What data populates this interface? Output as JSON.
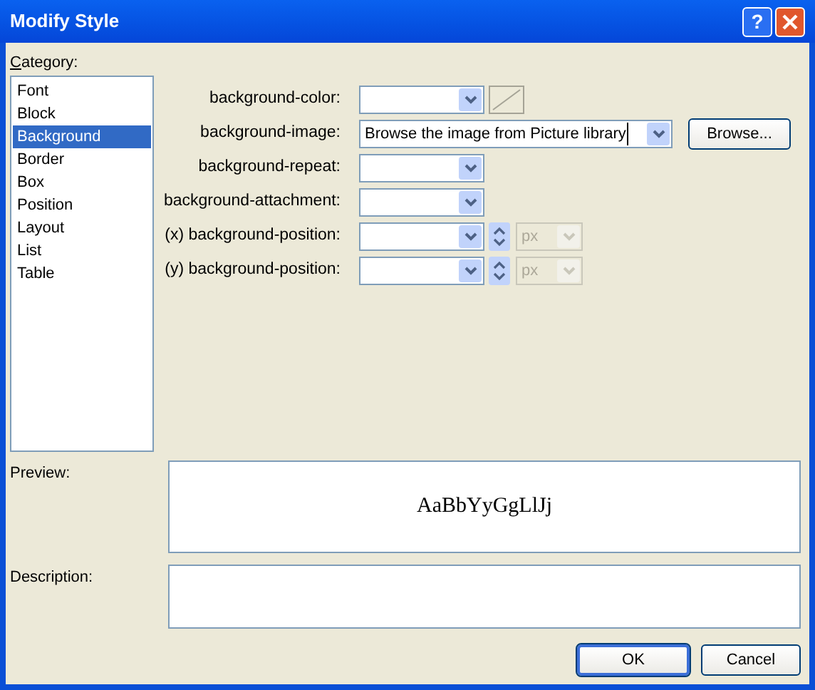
{
  "window": {
    "title": "Modify Style",
    "help_button": "?"
  },
  "category": {
    "label": "Category:",
    "items": [
      {
        "label": "Font",
        "selected": false
      },
      {
        "label": "Block",
        "selected": false
      },
      {
        "label": "Background",
        "selected": true
      },
      {
        "label": "Border",
        "selected": false
      },
      {
        "label": "Box",
        "selected": false
      },
      {
        "label": "Position",
        "selected": false
      },
      {
        "label": "Layout",
        "selected": false
      },
      {
        "label": "List",
        "selected": false
      },
      {
        "label": "Table",
        "selected": false
      }
    ]
  },
  "properties": [
    {
      "kind": "color",
      "label": "background-color:"
    },
    {
      "kind": "image",
      "label": "background-image:",
      "value": "Browse the image from Picture library",
      "button": "Browse..."
    },
    {
      "kind": "plain",
      "label": "background-repeat:"
    },
    {
      "kind": "plain",
      "label": "background-attachment:"
    },
    {
      "kind": "position",
      "label": "(x) background-position:",
      "unit": {
        "value": "px",
        "disabled": true
      }
    },
    {
      "kind": "position",
      "label": "(y) background-position:",
      "unit": {
        "value": "px",
        "disabled": true
      }
    }
  ],
  "preview": {
    "label": "Preview:",
    "sample": "AaBbYyGgLlJj"
  },
  "description": {
    "label": "Description:"
  },
  "buttons": [
    {
      "label": "OK",
      "default": true
    },
    {
      "label": "Cancel",
      "default": false
    }
  ]
}
